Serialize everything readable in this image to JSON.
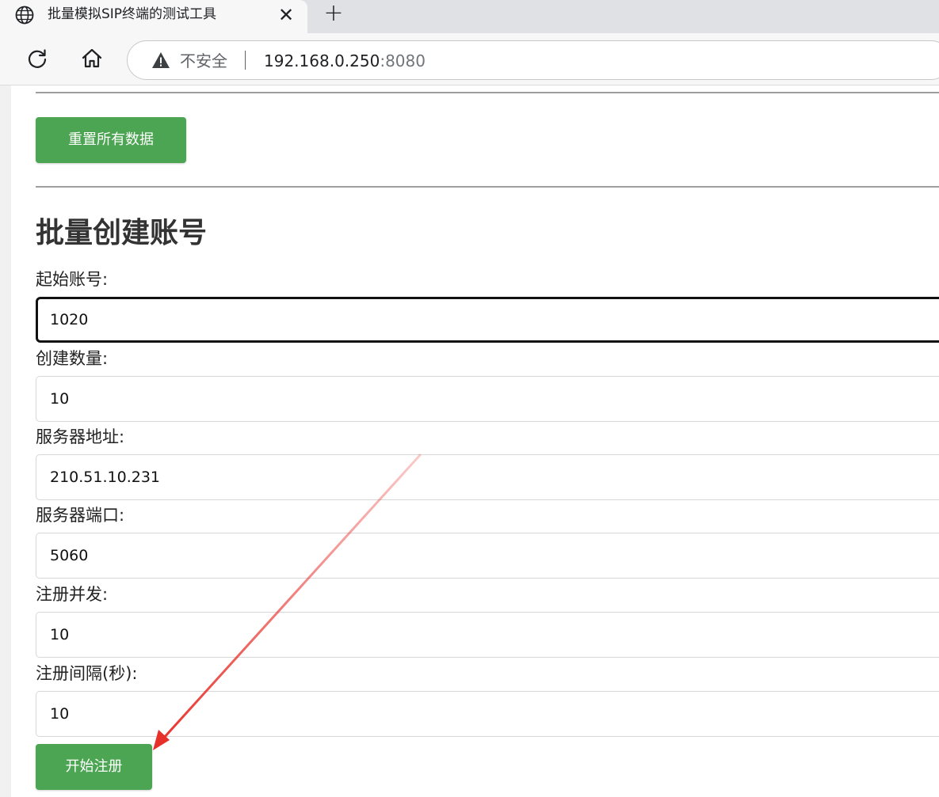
{
  "browser": {
    "tab_title": "批量模拟SIP终端的测试工具",
    "tab_close": "✕",
    "new_tab": "+",
    "security_label": "不安全",
    "url_host": "192.168.0.250",
    "url_port": ":8080"
  },
  "page": {
    "reset_button": "重置所有数据",
    "section_title": "批量创建账号",
    "fields": [
      {
        "label": "起始账号:",
        "value": "1020"
      },
      {
        "label": "创建数量:",
        "value": "10"
      },
      {
        "label": "服务器地址:",
        "value": "210.51.10.231"
      },
      {
        "label": "服务器端口:",
        "value": "5060"
      },
      {
        "label": "注册并发:",
        "value": "10"
      },
      {
        "label": "注册间隔(秒):",
        "value": "10"
      }
    ],
    "start_button": "开始注册"
  },
  "colors": {
    "button_green": "#4ca552",
    "annotation_arrow": "#e8302a"
  },
  "icons": {
    "tab": "globe-icon",
    "reload": "reload-icon",
    "home": "home-icon",
    "security": "warning-icon"
  }
}
